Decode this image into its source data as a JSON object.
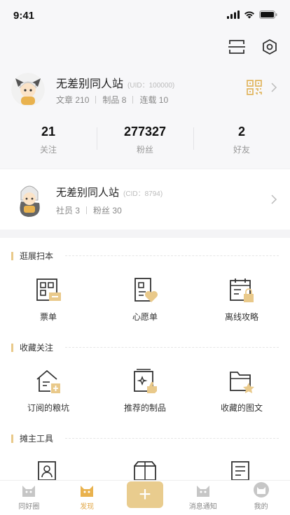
{
  "status": {
    "time": "9:41"
  },
  "profile": {
    "name": "无差别同人站",
    "uid": "(UID：100000)",
    "stats": [
      {
        "label": "文章",
        "value": "210"
      },
      {
        "label": "制品",
        "value": "8"
      },
      {
        "label": "连载",
        "value": "10"
      }
    ],
    "counts": [
      {
        "value": "21",
        "label": "关注"
      },
      {
        "value": "277327",
        "label": "粉丝"
      },
      {
        "value": "2",
        "label": "好友"
      }
    ]
  },
  "circle": {
    "name": "无差别同人站",
    "cid": "(CID：8794)",
    "members_label": "社员",
    "members": "3",
    "fans_label": "粉丝",
    "fans": "30"
  },
  "sections": [
    {
      "title": "逛展扫本",
      "items": [
        "票单",
        "心愿单",
        "离线攻略"
      ]
    },
    {
      "title": "收藏关注",
      "items": [
        "订阅的粮坑",
        "推荐的制品",
        "收藏的图文"
      ]
    },
    {
      "title": "摊主工具",
      "items": [
        "",
        "",
        ""
      ]
    }
  ],
  "tabs": [
    {
      "label": "同好圈"
    },
    {
      "label": "发现"
    },
    {
      "label": "+"
    },
    {
      "label": "消息通知"
    },
    {
      "label": "我的"
    }
  ],
  "colors": {
    "accent": "#e9c98a",
    "active_tab": "#e2a84a"
  }
}
